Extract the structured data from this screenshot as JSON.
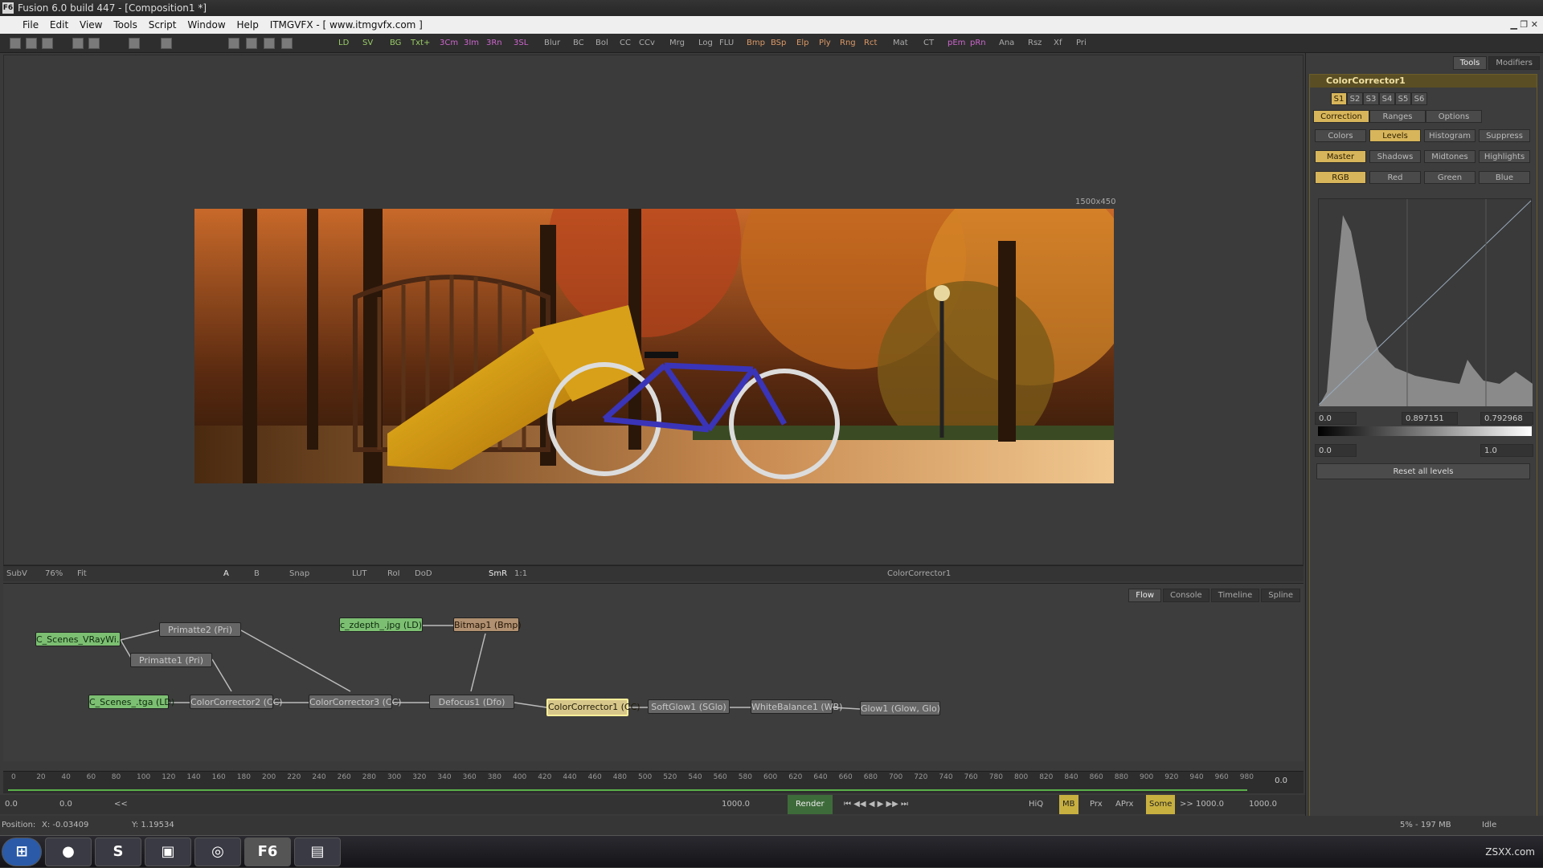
{
  "window": {
    "title": "Fusion 6.0 build 447 - [Composition1 *]",
    "app_icon": "F6",
    "watermark": "ZSXX.com"
  },
  "menu": [
    "File",
    "Edit",
    "View",
    "Tools",
    "Script",
    "Window",
    "Help",
    "ITMGVFX - [ www.itmgvfx.com ]"
  ],
  "toolbar": [
    "LD",
    "SV",
    "BG",
    "Txt+",
    "3Cm",
    "3Im",
    "3Rn",
    "3SL",
    "Blur",
    "BC",
    "Bol",
    "CC",
    "CCv",
    "Mrg",
    "Log",
    "FLU",
    "Bmp",
    "BSp",
    "Elp",
    "Ply",
    "Rng",
    "Rct",
    "Mat",
    "CT",
    "pEm",
    "pRn",
    "Ana",
    "Rsz",
    "Xf",
    "Pri"
  ],
  "viewer": {
    "resolution": "1500x450",
    "title": "ColorCorrector1"
  },
  "viewer_toolbar": {
    "subv": "SubV",
    "zoom": "76%",
    "fit": "Fit",
    "snap": "Snap",
    "lut": "LUT",
    "roi": "RoI",
    "dod": "DoD",
    "smr": "SmR",
    "one": "1:1",
    "a": "A",
    "b": "B"
  },
  "flow": {
    "tabs": [
      "Flow",
      "Console",
      "Timeline",
      "Spline"
    ],
    "nodes": [
      {
        "label": "C_Scenes_VRayWi..."
      },
      {
        "label": "Primatte2 (Pri)"
      },
      {
        "label": "Primatte1 (Pri)"
      },
      {
        "label": "c_zdepth_.jpg (LD)"
      },
      {
        "label": "Bitmap1 (Bmp)"
      },
      {
        "label": "C_Scenes_.tga (LD)"
      },
      {
        "label": "ColorCorrector2 (CC)"
      },
      {
        "label": "ColorCorrector3 (CC)"
      },
      {
        "label": "Defocus1 (Dfo)"
      },
      {
        "label": "ColorCorrector1 (CC)"
      },
      {
        "label": "SoftGlow1 (SGlo)"
      },
      {
        "label": "WhiteBalance1 (WB)"
      },
      {
        "label": "Glow1 (Glow, Glo)"
      }
    ]
  },
  "timeline": {
    "ticks": [
      "0",
      "20",
      "40",
      "60",
      "80",
      "100",
      "120",
      "140",
      "160",
      "180",
      "200",
      "220",
      "240",
      "260",
      "280",
      "300",
      "320",
      "340",
      "360",
      "380",
      "400",
      "420",
      "440",
      "460",
      "480",
      "500",
      "520",
      "540",
      "560",
      "580",
      "600",
      "620",
      "640",
      "660",
      "680",
      "700",
      "720",
      "740",
      "760",
      "780",
      "800",
      "820",
      "840",
      "860",
      "880",
      "900",
      "920",
      "940",
      "960",
      "980"
    ],
    "current": "0.0"
  },
  "controls": {
    "start": "0.0",
    "render_start": "0.0",
    "back": "<<",
    "end_field": "1000.0",
    "render": "Render",
    "hiq": "HiQ",
    "mb": "MB",
    "prx": "Prx",
    "aprx": "APrx",
    "some": "Some",
    "fwd": ">>",
    "render_end": "1000.0",
    "end": "1000.0"
  },
  "position": {
    "label": "Position:",
    "x": "X: -0.03409",
    "y": "Y: 1.19534"
  },
  "status": {
    "mem": "5% - 197 MB",
    "state": "Idle"
  },
  "sidebar": {
    "tabs": [
      "Tools",
      "Modifiers"
    ],
    "tool": "ColorCorrector1",
    "slots": [
      "S1",
      "S2",
      "S3",
      "S4",
      "S5",
      "S6"
    ],
    "tabs2": [
      "Correction",
      "Ranges",
      "Options"
    ],
    "modes": [
      "Colors",
      "Levels",
      "Histogram",
      "Suppress"
    ],
    "ranges": [
      "Master",
      "Shadows",
      "Midtones",
      "Highlights"
    ],
    "channels": [
      "RGB",
      "Red",
      "Green",
      "Blue"
    ],
    "levels": {
      "low": "0.0",
      "gamma": "0.897151",
      "high": "0.792968",
      "out_low": "0.0",
      "out_high": "1.0"
    },
    "reset": "Reset all levels"
  }
}
